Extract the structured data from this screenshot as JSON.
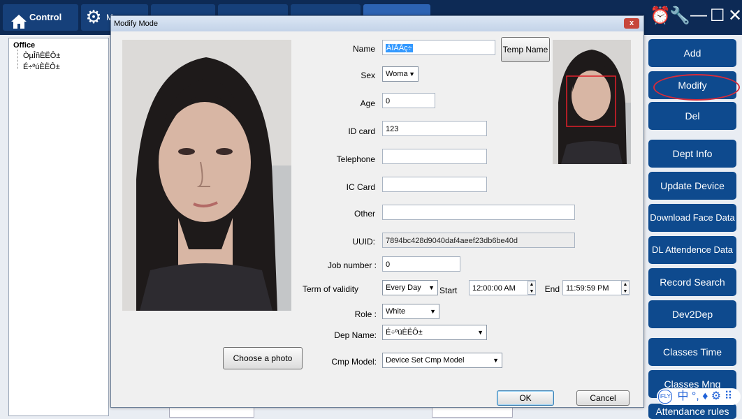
{
  "topbar": {
    "control_label": "Control",
    "tab2_label": "M"
  },
  "tree": {
    "root": "Office",
    "items": [
      "ÒµÎñÈËÔ±",
      "É÷ºúÈËÔ±"
    ]
  },
  "right_buttons": [
    "Add",
    "Modify",
    "Del",
    "Dept Info",
    "Update Device",
    "Download Face Data",
    "DL Attendence Data",
    "Record Search",
    "Dev2Dep",
    "Classes Time",
    "Classes Mng",
    "Attendance rules"
  ],
  "ime": {
    "text": "中 °, ♦ ⚙ ⠿"
  },
  "dialog": {
    "title": "Modify Mode",
    "close": "x",
    "fields": {
      "name_label": "Name",
      "name_value": "ÀÏÃÃç÷",
      "temp_name_button": "Temp Name",
      "sex_label": "Sex",
      "sex_value": "Woma",
      "age_label": "Age",
      "age_value": "0",
      "idcard_label": "ID card",
      "idcard_value": "123",
      "telephone_label": "Telephone",
      "telephone_value": "",
      "iccard_label": "IC Card",
      "iccard_value": "",
      "other_label": "Other",
      "other_value": "",
      "uuid_label": "UUID:",
      "uuid_value": "7894bc428d9040daf4aeef23db6be40d",
      "jobnumber_label": "Job number :",
      "jobnumber_value": "0",
      "validity_label": "Term of validity",
      "validity_value": "Every Day",
      "start_label": "Start",
      "start_value": "12:00:00 AM",
      "end_label": "End",
      "end_value": "11:59:59 PM",
      "role_label": "Role :",
      "role_value": "White",
      "depname_label": "Dep Name:",
      "depname_value": "É÷ºúÈËÔ±",
      "cmpmodel_label": "Cmp Model:",
      "cmpmodel_value": "Device Set Cmp Model"
    },
    "choose_photo_button": "Choose a photo",
    "ok_button": "OK",
    "cancel_button": "Cancel"
  },
  "colors": {
    "topbar": "#0d2a55",
    "right_button": "#0e4a8e",
    "highlight_ring": "#d72b3a",
    "face_box": "#e0202a"
  }
}
